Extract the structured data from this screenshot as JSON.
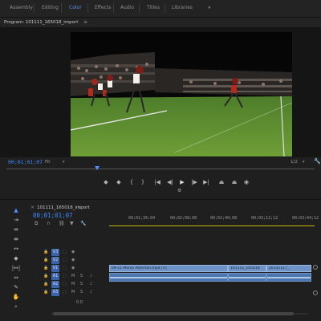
{
  "workspaces": {
    "tabs": [
      "Assembly",
      "Editing",
      "Color",
      "Effects",
      "Audio",
      "Titles",
      "Libraries"
    ],
    "active": "Color",
    "more": "»"
  },
  "program": {
    "title": "Program: 101111_165018_import",
    "menu_icon": "≡",
    "timecode": "00;01;01;07",
    "fit": "Fit",
    "resolution": "1/2",
    "caret": "▾"
  },
  "transport": {
    "buttons": [
      {
        "name": "marker-icon",
        "glyph": "◆"
      },
      {
        "name": "in-point-icon",
        "glyph": "{"
      },
      {
        "name": "out-point-icon",
        "glyph": "}"
      },
      {
        "name": "go-to-in-icon",
        "glyph": "|◀"
      },
      {
        "name": "step-back-icon",
        "glyph": "◀|"
      },
      {
        "name": "play-icon",
        "glyph": "▶"
      },
      {
        "name": "step-forward-icon",
        "glyph": "|▶"
      },
      {
        "name": "go-to-out-icon",
        "glyph": "▶|"
      },
      {
        "name": "lift-icon",
        "glyph": "⏏"
      },
      {
        "name": "extract-icon",
        "glyph": "⏏"
      },
      {
        "name": "export-frame-icon",
        "glyph": "◉"
      }
    ],
    "settings_glyph": "⚙"
  },
  "sequence": {
    "name": "101111_165018_import",
    "close": "×",
    "menu": "≡",
    "timecode": "00;01;01;07",
    "ruler_ticks": [
      "00;01;36;04",
      "00;02;08;08",
      "00;02;40;08",
      "00;03;12;12",
      "00;03;44;12"
    ]
  },
  "tools": [
    {
      "name": "selection-tool-icon",
      "glyph": "▲",
      "active": true
    },
    {
      "name": "track-select-tool-icon",
      "glyph": "⇥"
    },
    {
      "name": "ripple-edit-tool-icon",
      "glyph": "⇹"
    },
    {
      "name": "rolling-edit-tool-icon",
      "glyph": "⇼"
    },
    {
      "name": "rate-stretch-tool-icon",
      "glyph": "↔"
    },
    {
      "name": "razor-tool-icon",
      "glyph": "◆"
    },
    {
      "name": "slip-tool-icon",
      "glyph": "|↔|"
    },
    {
      "name": "slide-tool-icon",
      "glyph": "⇔"
    },
    {
      "name": "pen-tool-icon",
      "glyph": "✎"
    },
    {
      "name": "hand-tool-icon",
      "glyph": "✋"
    },
    {
      "name": "zoom-tool-icon",
      "glyph": "⌕"
    }
  ],
  "tracks": {
    "video": [
      {
        "label": "V3"
      },
      {
        "label": "V2"
      },
      {
        "label": "V1"
      }
    ],
    "audio": [
      {
        "label": "A1"
      },
      {
        "label": "A2"
      },
      {
        "label": "A3"
      }
    ],
    "zoom_label": "0.0",
    "lock_glyph": "🔒",
    "eye_glyph": "◉",
    "mute": "M",
    "solo": "S",
    "mic_glyph": "♪"
  },
  "clips": {
    "v1": [
      "09-11 Menlo Atherton.mp4 [V]",
      "101111_165018",
      "20141117_"
    ]
  },
  "colors": {
    "accent": "#3f8bff",
    "clip_video": "#6e93c6",
    "clip_audio": "#4c76ad",
    "playhead_line": "#c9b400"
  }
}
